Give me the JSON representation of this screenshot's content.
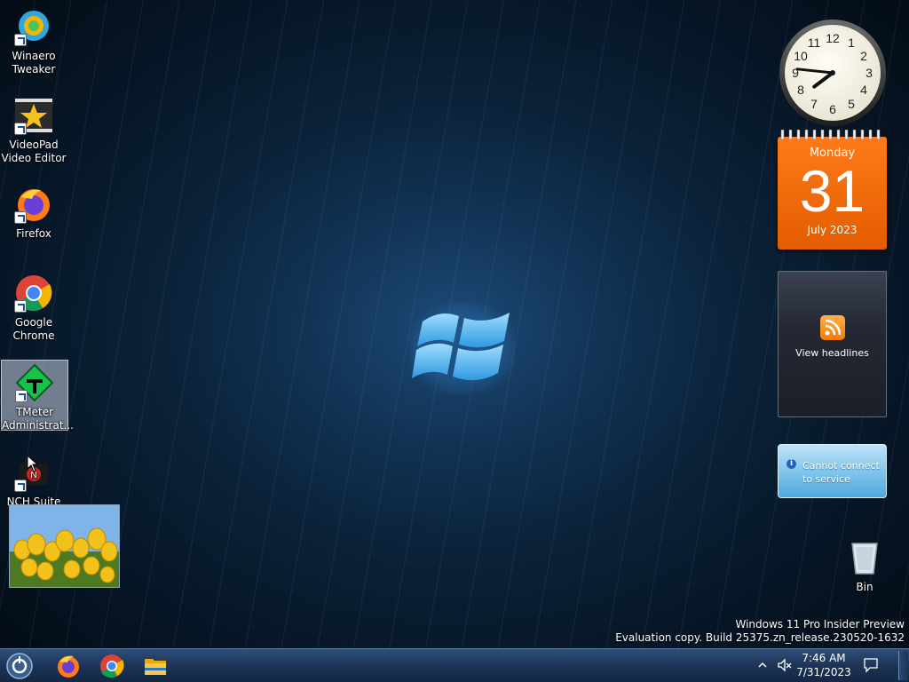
{
  "desktop": {
    "icons": [
      {
        "label_line1": "Winaero",
        "label_line2": "Tweaker",
        "icon": "winaero-tweaker-icon"
      },
      {
        "label_line1": "VideoPad",
        "label_line2": "Video Editor",
        "icon": "videopad-star-icon"
      },
      {
        "label_line1": "Firefox",
        "label_line2": "",
        "icon": "firefox-icon"
      },
      {
        "label_line1": "Google",
        "label_line2": "Chrome",
        "icon": "chrome-icon"
      },
      {
        "label_line1": "TMeter",
        "label_line2": "Administrat...",
        "icon": "tmeter-icon"
      },
      {
        "label_line1": "NCH Suite",
        "label_line2": "",
        "icon": "nch-suite-icon"
      }
    ],
    "recycle_bin": {
      "label": "Bin",
      "icon": "recycle-bin-icon"
    }
  },
  "gadgets": {
    "clock": {
      "hour": 7,
      "minute": 46
    },
    "calendar": {
      "weekday": "Monday",
      "day": "31",
      "month_year": "July 2023"
    },
    "feed": {
      "label": "View headlines",
      "icon": "rss-icon"
    },
    "weather": {
      "message_line1": "Cannot connect",
      "message_line2": "to service",
      "icon": "info-icon"
    }
  },
  "watermark": {
    "line1": "Windows 11 Pro Insider Preview",
    "line2": "Evaluation copy. Build 25375.zn_release.230520-1632"
  },
  "taskbar": {
    "pinned": [
      "start-orb-icon",
      "firefox-icon",
      "chrome-icon",
      "file-explorer-icon"
    ],
    "tray_icons": [
      "chevron-up-icon",
      "speaker-muted-icon",
      "notification-icon"
    ],
    "time": "7:46 AM",
    "date": "7/31/2023"
  },
  "colors": {
    "accent": "#e86a10",
    "taskbar": "#1d3456"
  }
}
